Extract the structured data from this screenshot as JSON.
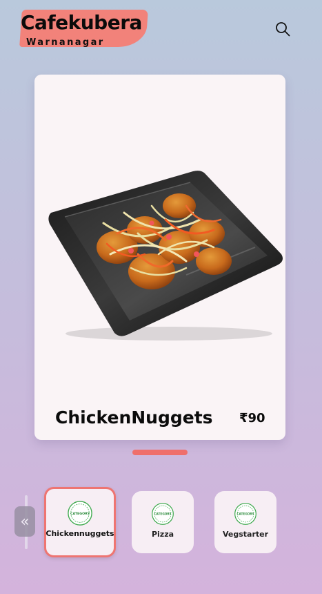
{
  "header": {
    "brand_name": "Cafekubera",
    "brand_location": "Warnanagar",
    "search_icon": "search-icon",
    "brand_accent_color": "#f2827a"
  },
  "featured": {
    "name": "ChickenNuggets",
    "price": "₹90",
    "image": "chicken-nuggets-plate-image"
  },
  "carousel": {
    "indicator_color": "#ef6f6b",
    "prev_icon": "double-chevron-left-icon",
    "prev_label": "«"
  },
  "categories": [
    {
      "label": "Chickennuggets",
      "icon": "category-badge-icon",
      "badge_text": "CATEGORY",
      "active": true
    },
    {
      "label": "Pizza",
      "icon": "category-badge-icon",
      "badge_text": "CATEGORY",
      "active": false
    },
    {
      "label": "Vegstarter",
      "icon": "category-badge-icon",
      "badge_text": "CATEGORY",
      "active": false
    }
  ]
}
